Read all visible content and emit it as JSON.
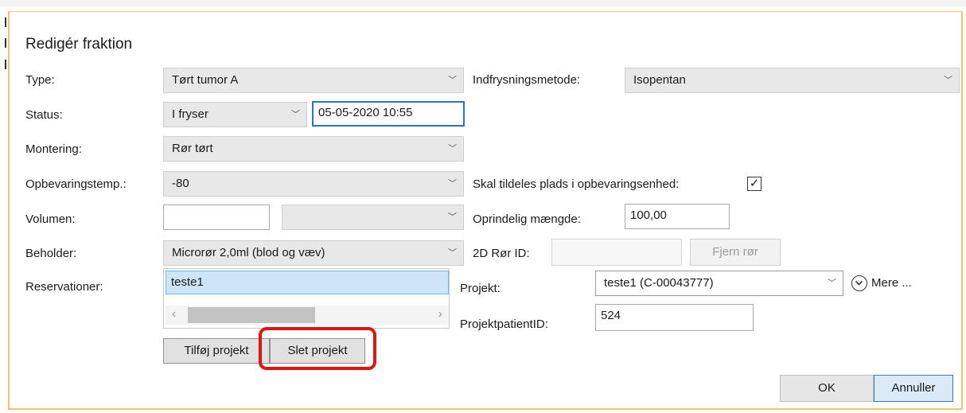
{
  "dialog": {
    "title": "Redigér fraktion"
  },
  "fields": {
    "type": {
      "label": "Type:",
      "value": "Tørt tumor A"
    },
    "freeze_method": {
      "label": "Indfrysningsmetode:",
      "value": "Isopentan"
    },
    "status": {
      "label": "Status:",
      "value": "I fryser",
      "datetime": "05-05-2020 10:55"
    },
    "mounting": {
      "label": "Montering:",
      "value": "Rør tørt"
    },
    "storage_temp": {
      "label": "Opbevaringstemp.:",
      "value": "-80"
    },
    "assign_storage": {
      "label": "Skal tildeles plads i opbevaringsenhed:",
      "checked": true
    },
    "volume": {
      "label": "Volumen:",
      "value": "",
      "unit": ""
    },
    "original_amount": {
      "label": "Oprindelig mængde:",
      "value": "100,00"
    },
    "container": {
      "label": "Beholder:",
      "value": "Microrør 2,0ml (blod og væv)"
    },
    "tube_id": {
      "label": "2D Rør ID:",
      "value": "",
      "remove_button": "Fjern rør"
    },
    "reservations": {
      "label": "Reservationer:",
      "items": [
        "teste1"
      ]
    },
    "project": {
      "label": "Projekt:",
      "value": "teste1 (C-00043777)",
      "more": "Mere ..."
    },
    "project_patient_id": {
      "label": "ProjektpatientID:",
      "value": "524"
    }
  },
  "buttons": {
    "add_project": "Tilføj projekt",
    "delete_project": "Slet projekt",
    "ok": "OK",
    "cancel": "Annuller"
  },
  "icons": {
    "dropdown": "chevron-down-icon",
    "check": "checkmark-icon",
    "more": "circle-chevron-down-icon"
  },
  "colors": {
    "highlight": "#e41313",
    "accent": "#2f7bd0",
    "dialog_border": "#f2c46a"
  }
}
